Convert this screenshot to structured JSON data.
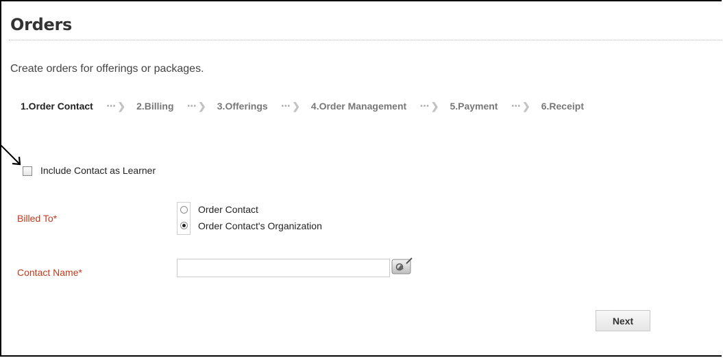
{
  "header": {
    "title": "Orders",
    "subtitle": "Create orders for offerings or packages."
  },
  "steps": [
    {
      "label": "1.Order Contact",
      "active": true
    },
    {
      "label": "2.Billing",
      "active": false
    },
    {
      "label": "3.Offerings",
      "active": false
    },
    {
      "label": "4.Order Management",
      "active": false
    },
    {
      "label": "5.Payment",
      "active": false
    },
    {
      "label": "6.Receipt",
      "active": false
    }
  ],
  "form": {
    "include_learner": {
      "label": "Include Contact as Learner",
      "checked": false
    },
    "billed_to": {
      "label": "Billed To*",
      "options": [
        {
          "label": "Order Contact",
          "selected": false
        },
        {
          "label": "Order Contact's Organization",
          "selected": true
        }
      ]
    },
    "contact_name": {
      "label": "Contact Name*",
      "value": "",
      "placeholder": ""
    }
  },
  "actions": {
    "next_label": "Next"
  },
  "colors": {
    "required_label": "#c0391b",
    "text": "#333333",
    "step_inactive": "#777777"
  },
  "icons": {
    "annotation": "arrow-pointer-icon",
    "picker": "contact-picker-icon",
    "step_separator": "dots-chevron-icon"
  }
}
